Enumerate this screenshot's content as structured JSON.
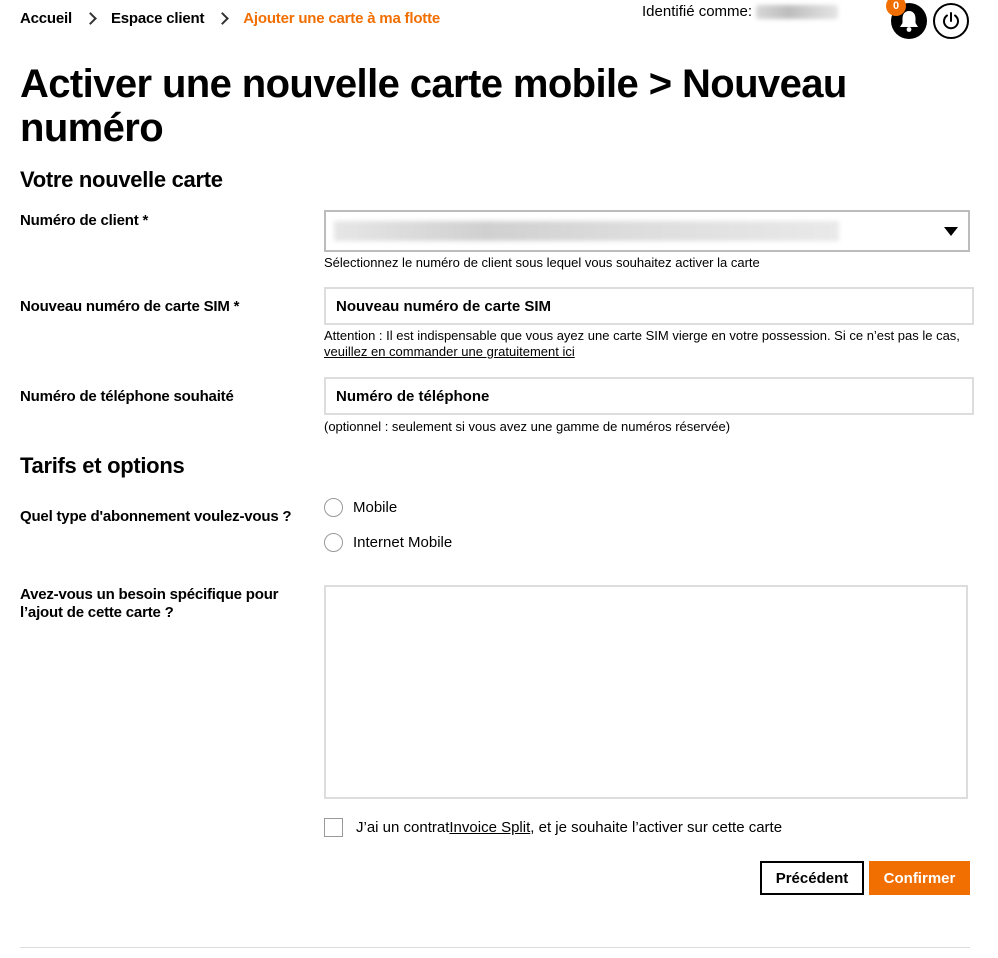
{
  "breadcrumb": {
    "items": [
      "Accueil",
      "Espace client"
    ],
    "current": "Ajouter une carte à ma flotte"
  },
  "header": {
    "identity_label": "Identifié comme:",
    "notification_count": "0"
  },
  "page": {
    "title": "Activer une nouvelle carte mobile > Nouveau numéro"
  },
  "section_card": {
    "title": "Votre nouvelle carte",
    "client_number": {
      "label": "Numéro de client *",
      "help": "Sélectionnez le numéro de client sous lequel vous souhaitez activer la carte"
    },
    "sim": {
      "label": "Nouveau numéro de carte SIM *",
      "placeholder": "Nouveau numéro de carte SIM",
      "help_prefix": "Attention : Il est indispensable que vous ayez une carte SIM vierge en votre possession. Si ce n’est pas le cas, ",
      "help_link": "veuillez en commander une gratuitement ici"
    },
    "phone": {
      "label": "Numéro de téléphone souhaité",
      "placeholder": "Numéro de téléphone",
      "help": "(optionnel : seulement si vous avez une gamme de numéros réservée)"
    }
  },
  "section_tariffs": {
    "title": "Tarifs et options",
    "subscription": {
      "label": "Quel type d'abonnement voulez-vous ?",
      "options": [
        "Mobile",
        "Internet Mobile"
      ]
    },
    "specific_need": {
      "label": "Avez-vous un besoin spécifique pour l’ajout de cette carte ?"
    },
    "invoice_split": {
      "prefix": "J’ai un contrat ",
      "link": "Invoice Split",
      "suffix": ", et je souhaite l’activer sur cette carte"
    }
  },
  "actions": {
    "previous": "Précédent",
    "confirm": "Confirmer"
  },
  "colors": {
    "accent": "#f16e00"
  }
}
